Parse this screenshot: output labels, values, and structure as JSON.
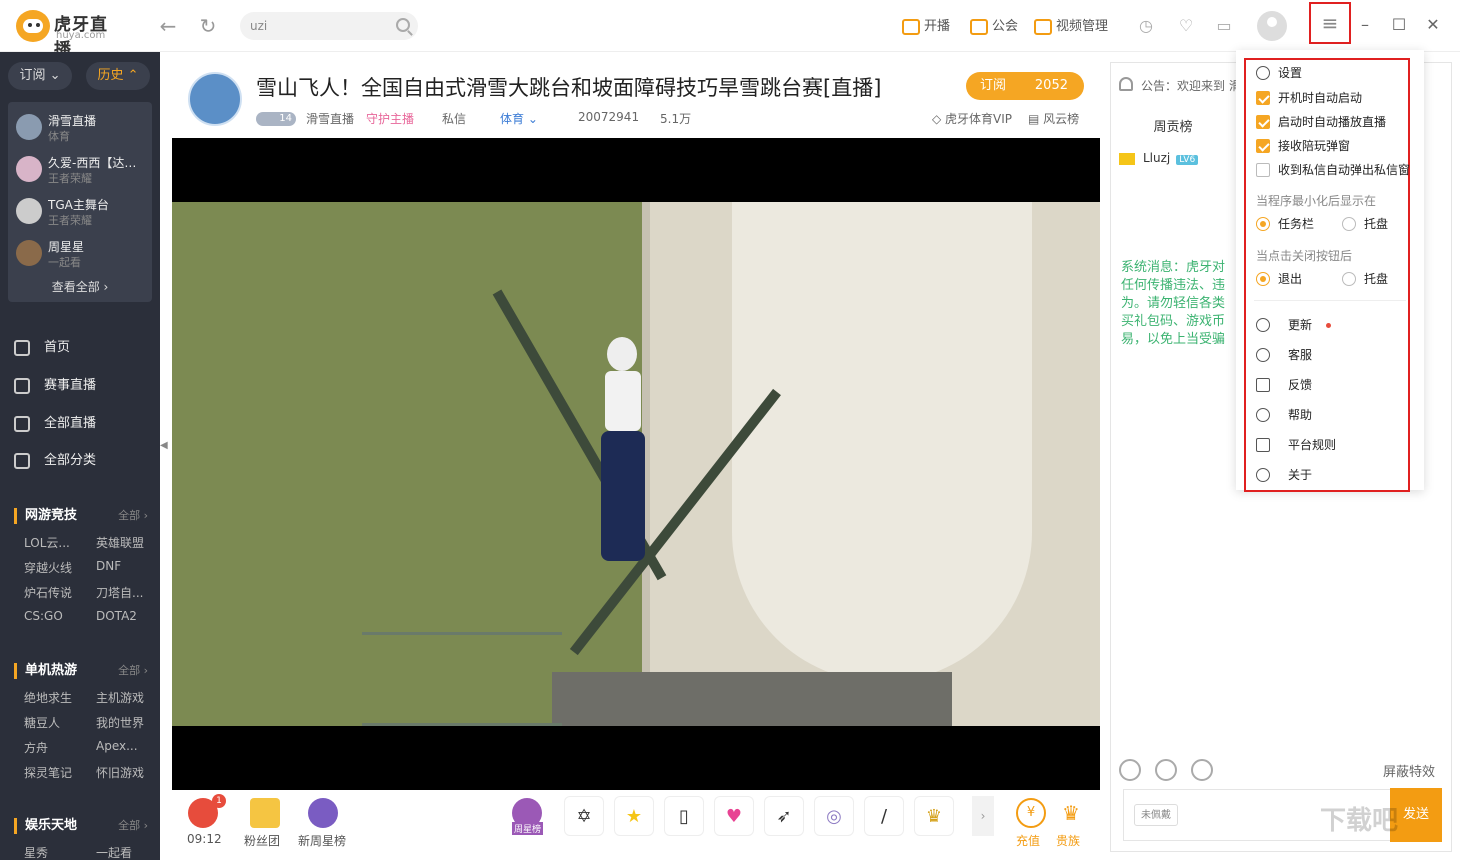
{
  "app": {
    "logo_text": "虎牙直播",
    "logo_sub": "huya.com"
  },
  "search": {
    "value": "uzi"
  },
  "toolbar": {
    "start_live": "开播",
    "guild": "公会",
    "video_manage": "视频管理"
  },
  "sidebar": {
    "tabs": [
      "订阅 ⌄",
      "历史 ⌃"
    ],
    "history": [
      {
        "name": "滑雪直播",
        "category": "体育"
      },
      {
        "name": "久爱-西西【达…",
        "category": "王者荣耀"
      },
      {
        "name": "TGA主舞台",
        "category": "王者荣耀"
      },
      {
        "name": "周星星",
        "category": "一起看"
      }
    ],
    "view_all": "查看全部 ›",
    "nav": [
      "首页",
      "赛事直播",
      "全部直播",
      "全部分类"
    ],
    "sections": [
      {
        "title": "网游竞技",
        "all": "全部 ›",
        "items": [
          "LOL云...",
          "英雄联盟",
          "穿越火线",
          "DNF",
          "炉石传说",
          "刀塔自...",
          "CS:GO",
          "DOTA2"
        ]
      },
      {
        "title": "单机热游",
        "all": "全部 ›",
        "items": [
          "绝地求生",
          "主机游戏",
          "糖豆人",
          "我的世界",
          "方舟",
          "Apex...",
          "探灵笔记",
          "怀旧游戏"
        ]
      },
      {
        "title": "娱乐天地",
        "all": "全部 ›",
        "items": [
          "星秀",
          "一起看"
        ]
      }
    ]
  },
  "stream": {
    "title": "雪山飞人！全国自由式滑雪大跳台和坡面障碍技巧旱雪跳台赛[直播]",
    "level": "14",
    "streamer": "滑雪直播",
    "guard": "守护主播",
    "message": "私信",
    "category": "体育 ⌄",
    "room_id": "20072941",
    "viewers": "5.1万",
    "vip": "虎牙体育VIP",
    "rank": "风云榜",
    "subscribe": "订阅",
    "subscribe_count": "2052"
  },
  "gifts": {
    "timer": "09:12",
    "timer_badge": "1",
    "fans": "粉丝团",
    "weekly_star": "新周星榜",
    "weekly_list": "周星榜",
    "recharge": "充值",
    "noble": "贵族",
    "recharge_icon": "¥"
  },
  "right_panel": {
    "notice": "公告：欢迎来到 滑",
    "tab": "周贡榜",
    "rank_user": "Lluzj",
    "rank_level": "LV6",
    "system_message": "系统消息：虎牙对任何传播违法、违为。请勿轻信各类买礼包码、游戏币易，以免上当受骗",
    "shield": "屏蔽特效",
    "unworn": "未佩戴",
    "send": "发送"
  },
  "menu": {
    "settings": "设置",
    "options": [
      {
        "label": "开机时自动启动",
        "checked": true
      },
      {
        "label": "启动时自动播放直播",
        "checked": true
      },
      {
        "label": "接收陪玩弹窗",
        "checked": true
      },
      {
        "label": "收到私信自动弹出私信窗",
        "checked": false
      }
    ],
    "minimize_header": "当程序最小化后显示在",
    "minimize_options": [
      "任务栏",
      "托盘"
    ],
    "close_header": "当点击关闭按钮后",
    "close_options": [
      "退出",
      "托盘"
    ],
    "links": [
      "更新",
      "客服",
      "反馈",
      "帮助",
      "平台规则",
      "关于"
    ]
  },
  "watermark": "下载吧",
  "colors": {
    "accent": "#f5a623",
    "highlight": "#e02020",
    "sidebar_bg": "#2b2f3a",
    "system_msg": "#3cb371"
  }
}
